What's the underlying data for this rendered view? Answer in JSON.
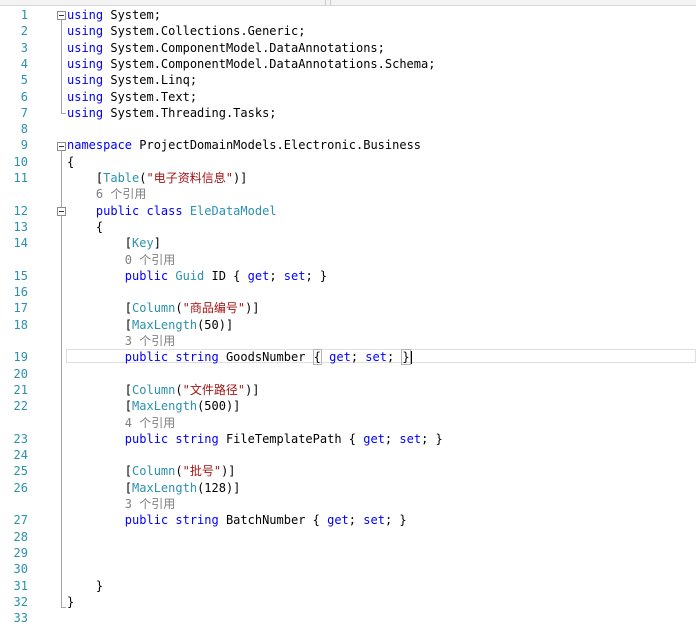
{
  "editor": {
    "lines": [
      {
        "n": "1",
        "tokens": [
          [
            "kw",
            "using"
          ],
          [
            "pl",
            " System;"
          ]
        ]
      },
      {
        "n": "2",
        "tokens": [
          [
            "kw",
            "using"
          ],
          [
            "pl",
            " System.Collections.Generic;"
          ]
        ]
      },
      {
        "n": "3",
        "tokens": [
          [
            "kw",
            "using"
          ],
          [
            "pl",
            " System.ComponentModel.DataAnnotations;"
          ]
        ]
      },
      {
        "n": "4",
        "tokens": [
          [
            "kw",
            "using"
          ],
          [
            "pl",
            " System.ComponentModel.DataAnnotations.Schema;"
          ]
        ]
      },
      {
        "n": "5",
        "tokens": [
          [
            "kw",
            "using"
          ],
          [
            "pl",
            " System.Linq;"
          ]
        ]
      },
      {
        "n": "6",
        "tokens": [
          [
            "kw",
            "using"
          ],
          [
            "pl",
            " System.Text;"
          ]
        ]
      },
      {
        "n": "7",
        "tokens": [
          [
            "kw",
            "using"
          ],
          [
            "pl",
            " System.Threading.Tasks;"
          ]
        ]
      },
      {
        "n": "8",
        "tokens": []
      },
      {
        "n": "9",
        "tokens": [
          [
            "kw",
            "namespace"
          ],
          [
            "pl",
            " ProjectDomainModels.Electronic.Business"
          ]
        ]
      },
      {
        "n": "10",
        "tokens": [
          [
            "pl",
            "{"
          ]
        ]
      },
      {
        "n": "11",
        "tokens": [
          [
            "pl",
            "    ["
          ],
          [
            "ty",
            "Table"
          ],
          [
            "pl",
            "("
          ],
          [
            "st",
            "\"电子资料信息\""
          ],
          [
            "pl",
            ")]"
          ]
        ]
      },
      {
        "n": "",
        "tokens": [
          [
            "ref",
            "    6 个引用"
          ]
        ]
      },
      {
        "n": "12",
        "tokens": [
          [
            "kw",
            "    public class "
          ],
          [
            "ty",
            "EleDataModel"
          ]
        ]
      },
      {
        "n": "13",
        "tokens": [
          [
            "pl",
            "    {"
          ]
        ]
      },
      {
        "n": "14",
        "tokens": [
          [
            "pl",
            "        ["
          ],
          [
            "ty",
            "Key"
          ],
          [
            "pl",
            "]"
          ]
        ]
      },
      {
        "n": "",
        "tokens": [
          [
            "ref",
            "        0 个引用"
          ]
        ]
      },
      {
        "n": "15",
        "tokens": [
          [
            "kw",
            "        public "
          ],
          [
            "ty",
            "Guid"
          ],
          [
            "pl",
            " ID { "
          ],
          [
            "kw",
            "get"
          ],
          [
            "pl",
            "; "
          ],
          [
            "kw",
            "set"
          ],
          [
            "pl",
            "; }"
          ]
        ]
      },
      {
        "n": "16",
        "tokens": []
      },
      {
        "n": "17",
        "tokens": [
          [
            "pl",
            "        ["
          ],
          [
            "ty",
            "Column"
          ],
          [
            "pl",
            "("
          ],
          [
            "st",
            "\"商品编号\""
          ],
          [
            "pl",
            ")]"
          ]
        ]
      },
      {
        "n": "18",
        "tokens": [
          [
            "pl",
            "        ["
          ],
          [
            "ty",
            "MaxLength"
          ],
          [
            "pl",
            "(50)]"
          ]
        ]
      },
      {
        "n": "",
        "tokens": [
          [
            "ref",
            "        3 个引用"
          ]
        ]
      },
      {
        "n": "19",
        "tokens": [
          [
            "kw",
            "        public string "
          ],
          [
            "pl",
            "GoodsNumber "
          ],
          [
            "br",
            "{"
          ],
          [
            "pl",
            " "
          ],
          [
            "kw",
            "get"
          ],
          [
            "pl",
            "; "
          ],
          [
            "kw",
            "set"
          ],
          [
            "pl",
            "; "
          ],
          [
            "br",
            "}"
          ],
          [
            "caret",
            ""
          ]
        ]
      },
      {
        "n": "20",
        "tokens": []
      },
      {
        "n": "21",
        "tokens": [
          [
            "pl",
            "        ["
          ],
          [
            "ty",
            "Column"
          ],
          [
            "pl",
            "("
          ],
          [
            "st",
            "\"文件路径\""
          ],
          [
            "pl",
            ")]"
          ]
        ]
      },
      {
        "n": "22",
        "tokens": [
          [
            "pl",
            "        ["
          ],
          [
            "ty",
            "MaxLength"
          ],
          [
            "pl",
            "(500)]"
          ]
        ]
      },
      {
        "n": "",
        "tokens": [
          [
            "ref",
            "        4 个引用"
          ]
        ]
      },
      {
        "n": "23",
        "tokens": [
          [
            "kw",
            "        public string "
          ],
          [
            "pl",
            "FileTemplatePath { "
          ],
          [
            "kw",
            "get"
          ],
          [
            "pl",
            "; "
          ],
          [
            "kw",
            "set"
          ],
          [
            "pl",
            "; }"
          ]
        ]
      },
      {
        "n": "24",
        "tokens": []
      },
      {
        "n": "25",
        "tokens": [
          [
            "pl",
            "        ["
          ],
          [
            "ty",
            "Column"
          ],
          [
            "pl",
            "("
          ],
          [
            "st",
            "\"批号\""
          ],
          [
            "pl",
            ")]"
          ]
        ]
      },
      {
        "n": "26",
        "tokens": [
          [
            "pl",
            "        ["
          ],
          [
            "ty",
            "MaxLength"
          ],
          [
            "pl",
            "(128)]"
          ]
        ]
      },
      {
        "n": "",
        "tokens": [
          [
            "ref",
            "        3 个引用"
          ]
        ]
      },
      {
        "n": "27",
        "tokens": [
          [
            "kw",
            "        public string "
          ],
          [
            "pl",
            "BatchNumber { "
          ],
          [
            "kw",
            "get"
          ],
          [
            "pl",
            "; "
          ],
          [
            "kw",
            "set"
          ],
          [
            "pl",
            "; }"
          ]
        ]
      },
      {
        "n": "28",
        "tokens": []
      },
      {
        "n": "29",
        "tokens": []
      },
      {
        "n": "30",
        "tokens": []
      },
      {
        "n": "31",
        "tokens": [
          [
            "pl",
            "    }"
          ]
        ]
      },
      {
        "n": "32",
        "tokens": [
          [
            "pl",
            "}"
          ]
        ]
      },
      {
        "n": "33",
        "tokens": []
      }
    ]
  }
}
